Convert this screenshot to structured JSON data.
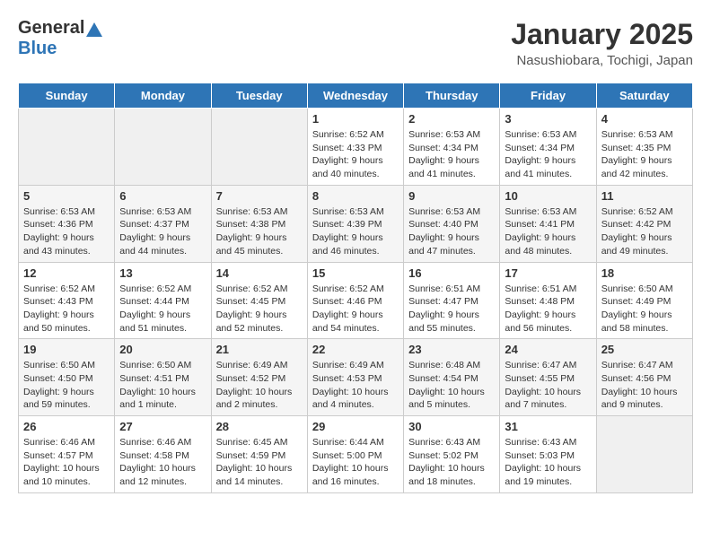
{
  "header": {
    "logo_general": "General",
    "logo_blue": "Blue",
    "month_title": "January 2025",
    "location": "Nasushiobara, Tochigi, Japan"
  },
  "weekdays": [
    "Sunday",
    "Monday",
    "Tuesday",
    "Wednesday",
    "Thursday",
    "Friday",
    "Saturday"
  ],
  "weeks": [
    [
      {
        "day": "",
        "info": ""
      },
      {
        "day": "",
        "info": ""
      },
      {
        "day": "",
        "info": ""
      },
      {
        "day": "1",
        "info": "Sunrise: 6:52 AM\nSunset: 4:33 PM\nDaylight: 9 hours\nand 40 minutes."
      },
      {
        "day": "2",
        "info": "Sunrise: 6:53 AM\nSunset: 4:34 PM\nDaylight: 9 hours\nand 41 minutes."
      },
      {
        "day": "3",
        "info": "Sunrise: 6:53 AM\nSunset: 4:34 PM\nDaylight: 9 hours\nand 41 minutes."
      },
      {
        "day": "4",
        "info": "Sunrise: 6:53 AM\nSunset: 4:35 PM\nDaylight: 9 hours\nand 42 minutes."
      }
    ],
    [
      {
        "day": "5",
        "info": "Sunrise: 6:53 AM\nSunset: 4:36 PM\nDaylight: 9 hours\nand 43 minutes."
      },
      {
        "day": "6",
        "info": "Sunrise: 6:53 AM\nSunset: 4:37 PM\nDaylight: 9 hours\nand 44 minutes."
      },
      {
        "day": "7",
        "info": "Sunrise: 6:53 AM\nSunset: 4:38 PM\nDaylight: 9 hours\nand 45 minutes."
      },
      {
        "day": "8",
        "info": "Sunrise: 6:53 AM\nSunset: 4:39 PM\nDaylight: 9 hours\nand 46 minutes."
      },
      {
        "day": "9",
        "info": "Sunrise: 6:53 AM\nSunset: 4:40 PM\nDaylight: 9 hours\nand 47 minutes."
      },
      {
        "day": "10",
        "info": "Sunrise: 6:53 AM\nSunset: 4:41 PM\nDaylight: 9 hours\nand 48 minutes."
      },
      {
        "day": "11",
        "info": "Sunrise: 6:52 AM\nSunset: 4:42 PM\nDaylight: 9 hours\nand 49 minutes."
      }
    ],
    [
      {
        "day": "12",
        "info": "Sunrise: 6:52 AM\nSunset: 4:43 PM\nDaylight: 9 hours\nand 50 minutes."
      },
      {
        "day": "13",
        "info": "Sunrise: 6:52 AM\nSunset: 4:44 PM\nDaylight: 9 hours\nand 51 minutes."
      },
      {
        "day": "14",
        "info": "Sunrise: 6:52 AM\nSunset: 4:45 PM\nDaylight: 9 hours\nand 52 minutes."
      },
      {
        "day": "15",
        "info": "Sunrise: 6:52 AM\nSunset: 4:46 PM\nDaylight: 9 hours\nand 54 minutes."
      },
      {
        "day": "16",
        "info": "Sunrise: 6:51 AM\nSunset: 4:47 PM\nDaylight: 9 hours\nand 55 minutes."
      },
      {
        "day": "17",
        "info": "Sunrise: 6:51 AM\nSunset: 4:48 PM\nDaylight: 9 hours\nand 56 minutes."
      },
      {
        "day": "18",
        "info": "Sunrise: 6:50 AM\nSunset: 4:49 PM\nDaylight: 9 hours\nand 58 minutes."
      }
    ],
    [
      {
        "day": "19",
        "info": "Sunrise: 6:50 AM\nSunset: 4:50 PM\nDaylight: 9 hours\nand 59 minutes."
      },
      {
        "day": "20",
        "info": "Sunrise: 6:50 AM\nSunset: 4:51 PM\nDaylight: 10 hours\nand 1 minute."
      },
      {
        "day": "21",
        "info": "Sunrise: 6:49 AM\nSunset: 4:52 PM\nDaylight: 10 hours\nand 2 minutes."
      },
      {
        "day": "22",
        "info": "Sunrise: 6:49 AM\nSunset: 4:53 PM\nDaylight: 10 hours\nand 4 minutes."
      },
      {
        "day": "23",
        "info": "Sunrise: 6:48 AM\nSunset: 4:54 PM\nDaylight: 10 hours\nand 5 minutes."
      },
      {
        "day": "24",
        "info": "Sunrise: 6:47 AM\nSunset: 4:55 PM\nDaylight: 10 hours\nand 7 minutes."
      },
      {
        "day": "25",
        "info": "Sunrise: 6:47 AM\nSunset: 4:56 PM\nDaylight: 10 hours\nand 9 minutes."
      }
    ],
    [
      {
        "day": "26",
        "info": "Sunrise: 6:46 AM\nSunset: 4:57 PM\nDaylight: 10 hours\nand 10 minutes."
      },
      {
        "day": "27",
        "info": "Sunrise: 6:46 AM\nSunset: 4:58 PM\nDaylight: 10 hours\nand 12 minutes."
      },
      {
        "day": "28",
        "info": "Sunrise: 6:45 AM\nSunset: 4:59 PM\nDaylight: 10 hours\nand 14 minutes."
      },
      {
        "day": "29",
        "info": "Sunrise: 6:44 AM\nSunset: 5:00 PM\nDaylight: 10 hours\nand 16 minutes."
      },
      {
        "day": "30",
        "info": "Sunrise: 6:43 AM\nSunset: 5:02 PM\nDaylight: 10 hours\nand 18 minutes."
      },
      {
        "day": "31",
        "info": "Sunrise: 6:43 AM\nSunset: 5:03 PM\nDaylight: 10 hours\nand 19 minutes."
      },
      {
        "day": "",
        "info": ""
      }
    ]
  ]
}
